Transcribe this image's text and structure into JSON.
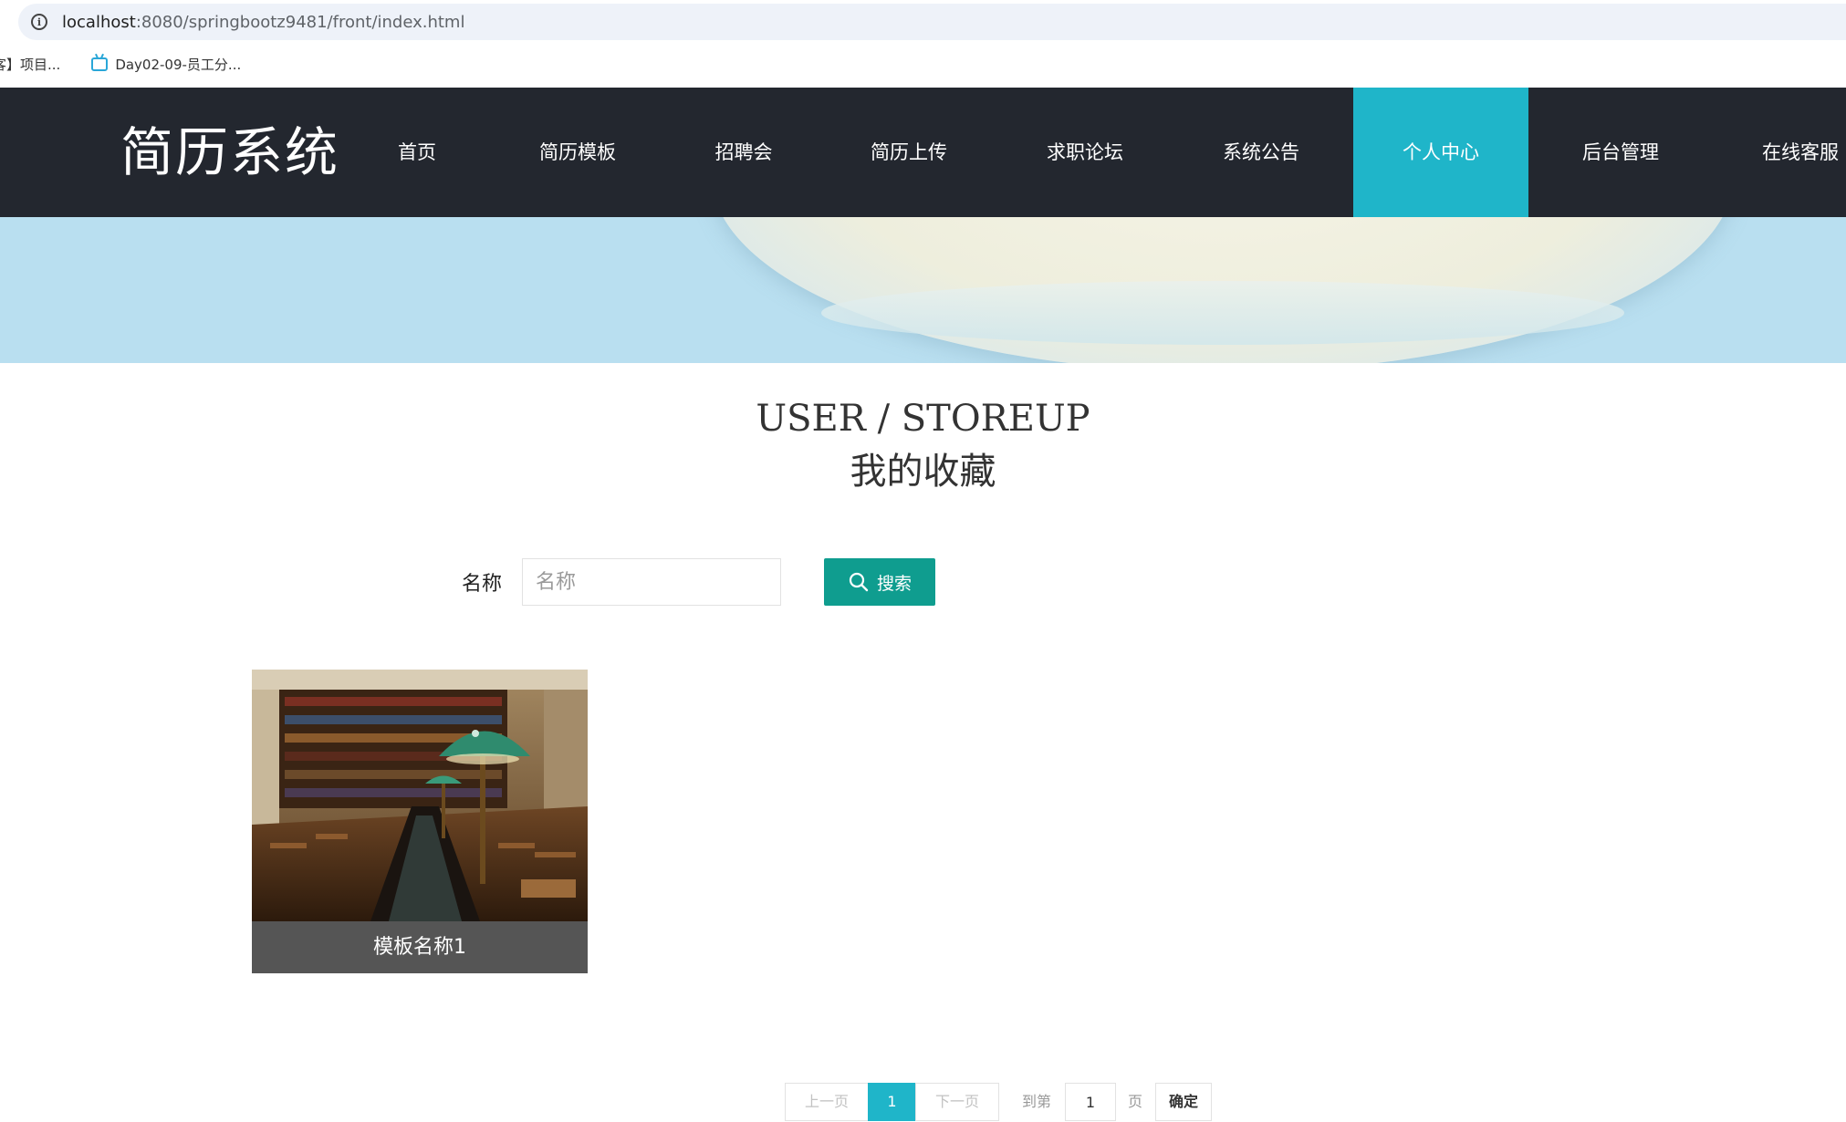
{
  "browser": {
    "url_host": "localhost",
    "url_rest": ":8080/springbootz9481/front/index.html",
    "bookmarks": [
      "客】项目...",
      "Day02-09-员工分..."
    ]
  },
  "nav": {
    "logo": "简历系统",
    "items": [
      "首页",
      "简历模板",
      "招聘会",
      "简历上传",
      "求职论坛",
      "系统公告",
      "个人中心",
      "后台管理",
      "在线客服"
    ],
    "active_index": 6,
    "active_color": "#1fb5c9",
    "bg_color": "#23272f"
  },
  "page": {
    "title_en": "USER / STOREUP",
    "title_cn": "我的收藏"
  },
  "search": {
    "label": "名称",
    "placeholder": "名称",
    "value": "",
    "button_label": "搜索",
    "button_color": "#0f9d8f"
  },
  "items": [
    {
      "name": "模板名称1"
    }
  ],
  "pager": {
    "prev_label": "上一页",
    "current_page": "1",
    "next_label": "下一页",
    "goto_label": "到第",
    "goto_value": "1",
    "page_unit": "页",
    "confirm_label": "确定"
  }
}
